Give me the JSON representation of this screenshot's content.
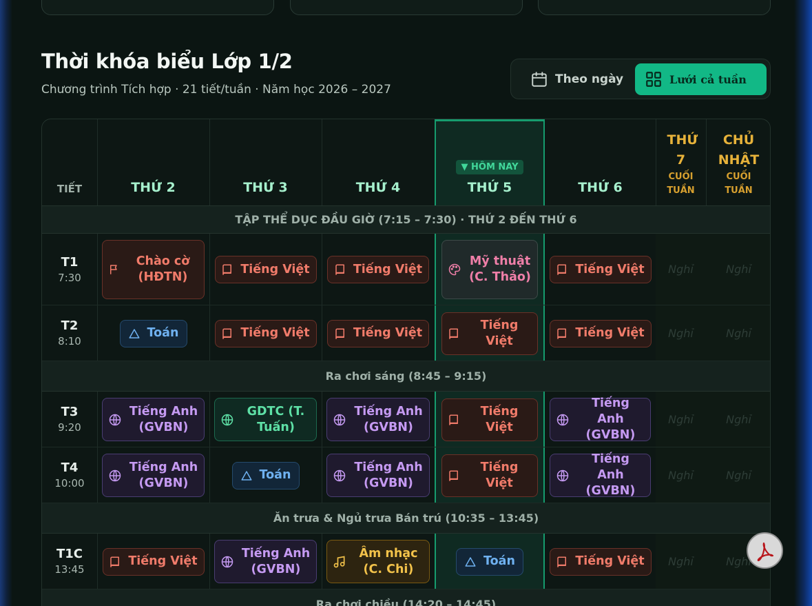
{
  "page": {
    "title": "Thời khóa biểu Lớp 1/2",
    "subtitle": "Chương trình Tích hợp · 21 tiết/tuần · Năm học 2026 – 2027"
  },
  "view_toggle": {
    "by_day": "Theo ngày",
    "week_grid": "Lưới cả tuần",
    "active": "week_grid"
  },
  "table": {
    "period_header": "TIẾT",
    "days": [
      "THỨ 2",
      "THỨ 3",
      "THỨ 4",
      "THỨ 5",
      "THỨ 6"
    ],
    "today_badge": "▼ HÔM NAY",
    "today_index": 3,
    "weekend": [
      {
        "label": "THỨ 7",
        "sub": "CUỐI TUẦN"
      },
      {
        "label": "CHỦ NHẬT",
        "sub": "CUỐI TUẦN"
      }
    ],
    "off_label": "Nghỉ",
    "bands": {
      "morning_exercise": "TẬP THỂ DỤC ĐẦU GIỜ (7:15 – 7:30) · THỨ 2 ĐẾN THỨ 6",
      "morning_break": "Ra chơi sáng (8:45 – 9:15)",
      "lunch": "Ăn trưa & Ngủ trưa Bán trú (10:35 – 13:45)",
      "afternoon_break": "Ra chơi chiều (14:20 – 14:45)"
    },
    "periods": [
      {
        "code": "T1",
        "time": "7:30",
        "cells": [
          {
            "subject": "Chào cờ (HĐTN)",
            "icon": "flag-icon",
            "color": "red"
          },
          {
            "subject": "Tiếng Việt",
            "icon": "book-icon",
            "color": "red"
          },
          {
            "subject": "Tiếng Việt",
            "icon": "book-icon",
            "color": "red"
          },
          {
            "subject": "Mỹ thuật (C. Thảo)",
            "icon": "palette-icon",
            "color": "pink"
          },
          {
            "subject": "Tiếng Việt",
            "icon": "book-icon",
            "color": "red"
          }
        ]
      },
      {
        "code": "T2",
        "time": "8:10",
        "cells": [
          {
            "subject": "Toán",
            "icon": "triangle-icon",
            "color": "blue"
          },
          {
            "subject": "Tiếng Việt",
            "icon": "book-icon",
            "color": "red"
          },
          {
            "subject": "Tiếng Việt",
            "icon": "book-icon",
            "color": "red"
          },
          {
            "subject": "Tiếng Việt",
            "icon": "book-icon",
            "color": "red"
          },
          {
            "subject": "Tiếng Việt",
            "icon": "book-icon",
            "color": "red"
          }
        ]
      },
      {
        "code": "T3",
        "time": "9:20",
        "cells": [
          {
            "subject": "Tiếng Anh (GVBN)",
            "icon": "globe-icon",
            "color": "purple"
          },
          {
            "subject": "GDTC (T. Tuấn)",
            "icon": "globe-icon",
            "color": "green"
          },
          {
            "subject": "Tiếng Anh (GVBN)",
            "icon": "globe-icon",
            "color": "purple"
          },
          {
            "subject": "Tiếng Việt",
            "icon": "book-icon",
            "color": "red"
          },
          {
            "subject": "Tiếng Anh (GVBN)",
            "icon": "globe-icon",
            "color": "purple"
          }
        ]
      },
      {
        "code": "T4",
        "time": "10:00",
        "cells": [
          {
            "subject": "Tiếng Anh (GVBN)",
            "icon": "globe-icon",
            "color": "purple"
          },
          {
            "subject": "Toán",
            "icon": "triangle-icon",
            "color": "blue"
          },
          {
            "subject": "Tiếng Anh (GVBN)",
            "icon": "globe-icon",
            "color": "purple"
          },
          {
            "subject": "Tiếng Việt",
            "icon": "book-icon",
            "color": "red"
          },
          {
            "subject": "Tiếng Anh (GVBN)",
            "icon": "globe-icon",
            "color": "purple"
          }
        ]
      },
      {
        "code": "T1C",
        "time": "13:45",
        "cells": [
          {
            "subject": "Tiếng Việt",
            "icon": "book-icon",
            "color": "red"
          },
          {
            "subject": "Tiếng Anh (GVBN)",
            "icon": "globe-icon",
            "color": "purple"
          },
          {
            "subject": "Âm nhạc (C. Chi)",
            "icon": "music-icon",
            "color": "yellow"
          },
          {
            "subject": "Toán",
            "icon": "triangle-icon",
            "color": "blue"
          },
          {
            "subject": "Tiếng Việt",
            "icon": "book-icon",
            "color": "red"
          }
        ]
      }
    ]
  },
  "floating": {
    "pdf_icon": "pdf-icon"
  },
  "colors": {
    "accent": "#12b886",
    "weekend": "#e7b23a",
    "today_border": "#169c6e"
  }
}
